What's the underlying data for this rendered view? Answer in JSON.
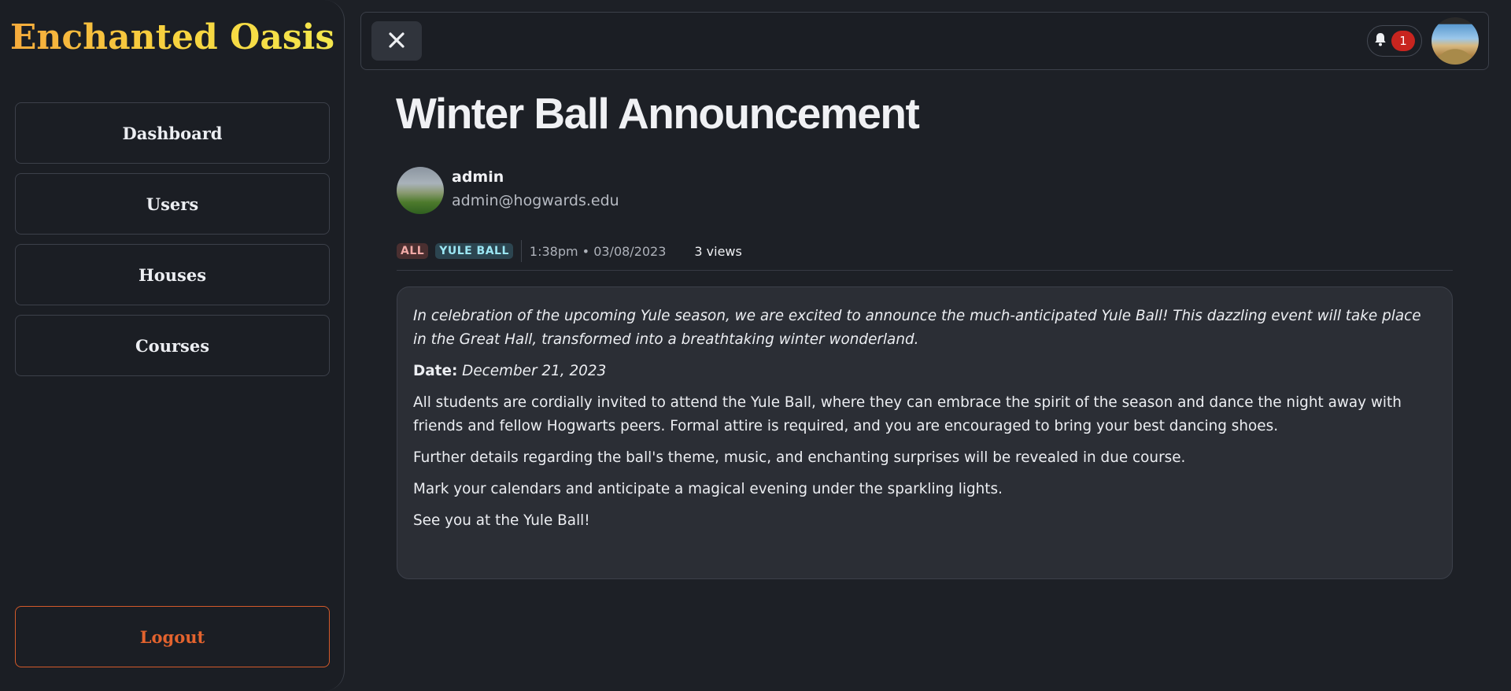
{
  "app": {
    "brand": "Enchanted Oasis"
  },
  "sidebar": {
    "items": [
      {
        "label": "Dashboard"
      },
      {
        "label": "Users"
      },
      {
        "label": "Houses"
      },
      {
        "label": "Courses"
      }
    ],
    "logout_label": "Logout"
  },
  "topbar": {
    "notification_count": "1"
  },
  "post": {
    "title": "Winter Ball Announcement",
    "author": {
      "name": "admin",
      "email": "admin@hogwards.edu"
    },
    "tags": [
      "ALL",
      "YULE BALL"
    ],
    "timestamp": "1:38pm • 03/08/2023",
    "views": "3 views",
    "body": {
      "intro": "In celebration of the upcoming Yule season, we are excited to announce the much-anticipated Yule Ball! This dazzling event will take place in the Great Hall, transformed into a breathtaking winter wonderland.",
      "date_label": "Date:",
      "date_value": "December 21, 2023",
      "paragraphs": [
        "All students are cordially invited to attend the Yule Ball, where they can embrace the spirit of the season and dance the night away with friends and fellow Hogwarts peers. Formal attire is required, and you are encouraged to bring your best dancing shoes.",
        "Further details regarding the ball's theme, music, and enchanting surprises will be revealed in due course.",
        "Mark your calendars and anticipate a magical evening under the sparkling lights.",
        "See you at the Yule Ball!"
      ]
    }
  },
  "colors": {
    "background": "#1d2026",
    "accent_logout": "#e3632e",
    "brand_gradient_start": "#f6a83c",
    "brand_gradient_end": "#f4e84e",
    "badge_red": "#c8251f"
  },
  "icons": {
    "close": "close-icon",
    "notification": "bell-icon"
  }
}
